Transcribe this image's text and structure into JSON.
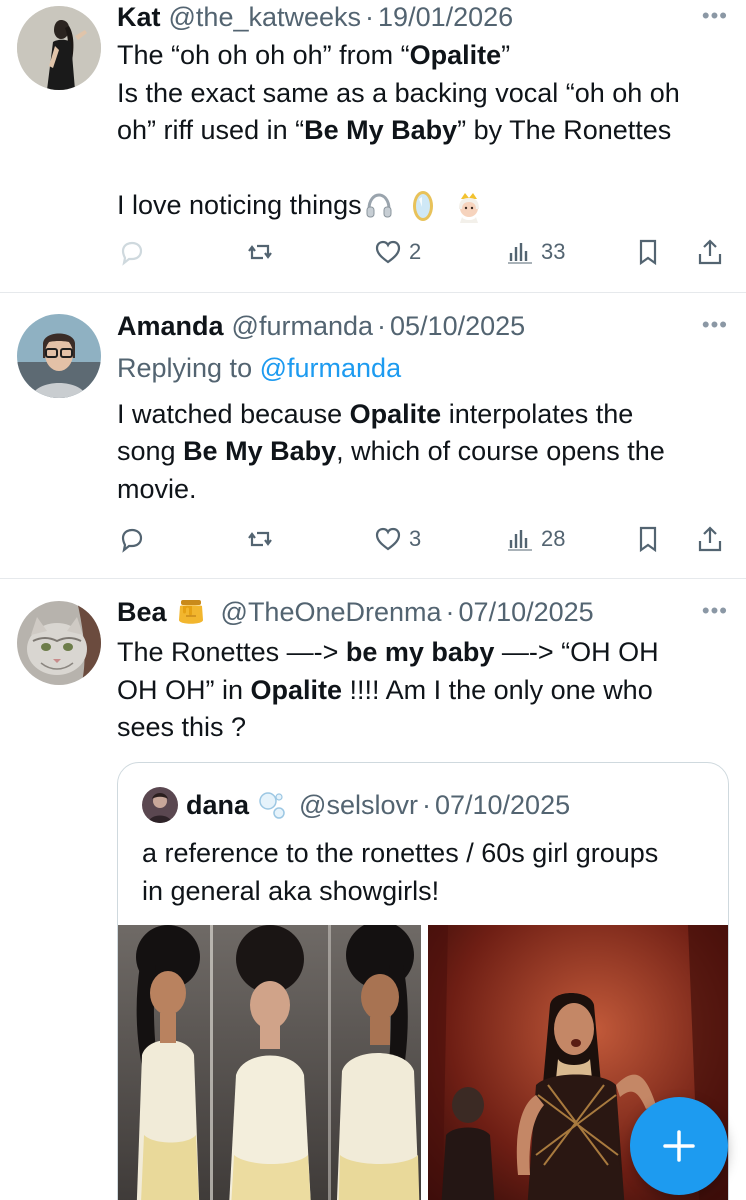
{
  "tweets": [
    {
      "name": "Kat",
      "handle": "@the_katweeks",
      "sep": "·",
      "date": "19/01/2026",
      "more": "•••",
      "line1_a": "The “oh oh oh oh” from “",
      "line1_b": "Opalite",
      "line1_c": "”",
      "line2": "Is the exact same as a backing vocal “oh oh oh",
      "line3_a": "oh” riff used in “",
      "line3_b": "Be My Baby",
      "line3_c": "” by The Ronettes",
      "line4": "I love noticing things",
      "emoji_names": [
        "headphone-icon",
        "mirror-icon",
        "princess-icon"
      ],
      "likes": "2",
      "views": "33"
    },
    {
      "name": "Amanda",
      "handle": "@furmanda",
      "sep": "·",
      "date": "05/10/2025",
      "more": "•••",
      "replying_label": "Replying to",
      "replying_handle": "@furmanda",
      "line1_a": "I watched because ",
      "line1_b": "Opalite",
      "line1_c": " interpolates the",
      "line2_a": "song ",
      "line2_b": "Be My Baby",
      "line2_c": ", which of course opens the",
      "line3": "movie.",
      "likes": "3",
      "views": "28"
    },
    {
      "name": "Bea",
      "name_emoji": "honey-pot-icon",
      "handle": "@TheOneDrenma",
      "sep": "·",
      "date": "07/10/2025",
      "more": "•••",
      "line1_a": "The Ronettes —-> ",
      "line1_b": "be my baby",
      "line1_c": " —-> “OH OH",
      "line2_a": "OH OH” in ",
      "line2_b": "Opalite",
      "line2_c": " !!!! Am I the only one who",
      "line3": "sees this ?",
      "quote": {
        "name": "dana",
        "name_emoji": "bubbles-icon",
        "handle": "@selslovr",
        "sep": "·",
        "date": "07/10/2025",
        "line1": "a reference to the ronettes / 60s girl groups",
        "line2": "in general aka showgirls!"
      }
    }
  ],
  "colors": {
    "text": "#0f1419",
    "secondary": "#536471",
    "link": "#1d9bf0",
    "fab": "#1d9bf0",
    "divider": "#e6e9ec"
  },
  "fab_icon": "plus-icon"
}
